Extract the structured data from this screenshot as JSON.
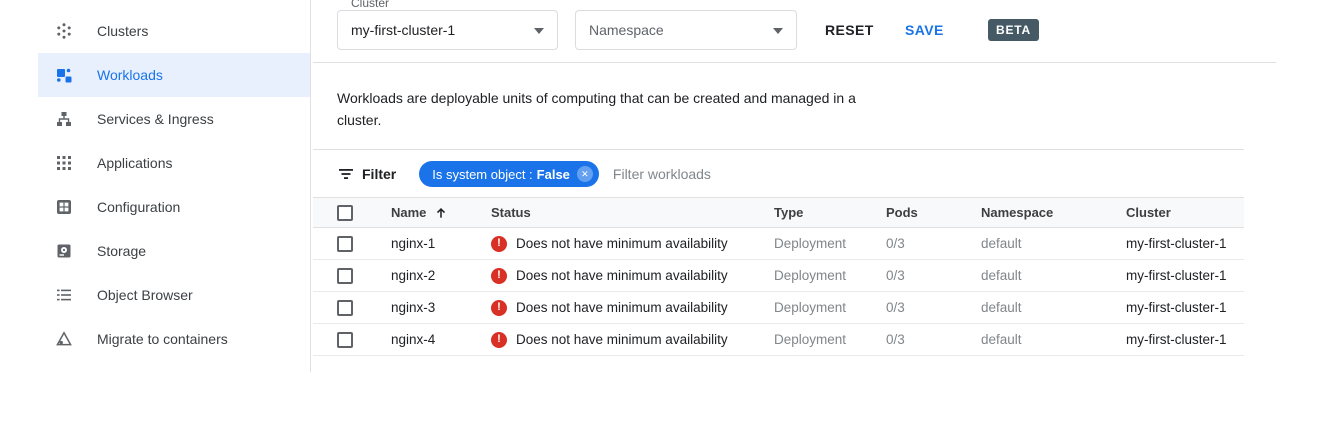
{
  "sidebar": {
    "items": [
      {
        "label": "Clusters",
        "selected": false
      },
      {
        "label": "Workloads",
        "selected": true
      },
      {
        "label": "Services & Ingress",
        "selected": false
      },
      {
        "label": "Applications",
        "selected": false
      },
      {
        "label": "Configuration",
        "selected": false
      },
      {
        "label": "Storage",
        "selected": false
      },
      {
        "label": "Object Browser",
        "selected": false
      },
      {
        "label": "Migrate to containers",
        "selected": false
      }
    ]
  },
  "toolbar": {
    "cluster_label": "Cluster",
    "cluster_value": "my-first-cluster-1",
    "namespace_placeholder": "Namespace",
    "reset": "RESET",
    "save": "SAVE",
    "beta": "BETA"
  },
  "description": "Workloads are deployable units of computing that can be created and managed in a cluster.",
  "filter": {
    "label": "Filter",
    "chip_text": "Is system object :",
    "chip_value": "False",
    "placeholder": "Filter workloads"
  },
  "table": {
    "columns": {
      "name": "Name",
      "status": "Status",
      "type": "Type",
      "pods": "Pods",
      "namespace": "Namespace",
      "cluster": "Cluster"
    },
    "sort": {
      "column": "Name",
      "direction": "ascending"
    },
    "rows": [
      {
        "name": "nginx-1",
        "status": "Does not have minimum availability",
        "type": "Deployment",
        "pods": "0/3",
        "namespace": "default",
        "cluster": "my-first-cluster-1"
      },
      {
        "name": "nginx-2",
        "status": "Does not have minimum availability",
        "type": "Deployment",
        "pods": "0/3",
        "namespace": "default",
        "cluster": "my-first-cluster-1"
      },
      {
        "name": "nginx-3",
        "status": "Does not have minimum availability",
        "type": "Deployment",
        "pods": "0/3",
        "namespace": "default",
        "cluster": "my-first-cluster-1"
      },
      {
        "name": "nginx-4",
        "status": "Does not have minimum availability",
        "type": "Deployment",
        "pods": "0/3",
        "namespace": "default",
        "cluster": "my-first-cluster-1"
      }
    ]
  },
  "icons": {
    "error_glyph": "!",
    "close_glyph": "✕"
  },
  "colors": {
    "accent": "#1a73e8",
    "selected_bg": "#e8f0fe",
    "error": "#d93025",
    "beta_bg": "#455a64",
    "border": "#dadce0",
    "row_border": "#e8eaed",
    "header_bg": "#f8f9fa",
    "text_dark": "#202124",
    "text_gray": "#5f6368",
    "text_muted": "#80868b"
  }
}
